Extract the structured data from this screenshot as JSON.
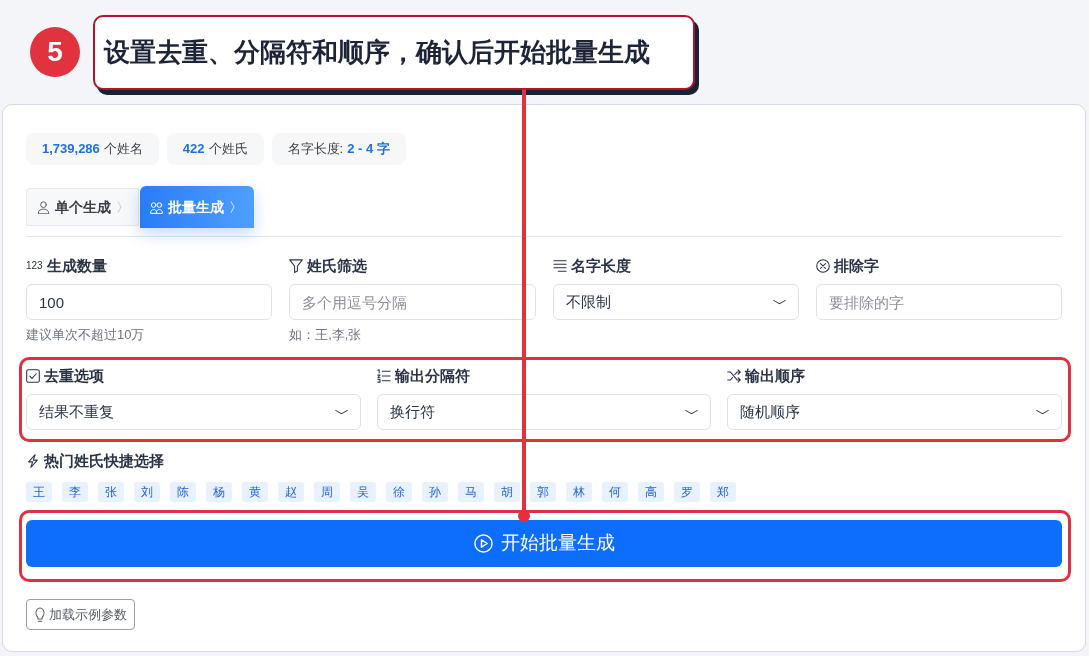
{
  "annotation": {
    "step": "5",
    "text": "设置去重、分隔符和顺序，确认后开始批量生成"
  },
  "stats": [
    {
      "kind": "count",
      "value": "1,739,286",
      "label": "个姓名"
    },
    {
      "kind": "count",
      "value": "422",
      "label": "个姓氏"
    },
    {
      "kind": "range",
      "label": "名字长度:",
      "value": "2 - 4 字"
    }
  ],
  "tabs": [
    {
      "label": "单个生成",
      "selected": false
    },
    {
      "label": "批量生成",
      "selected": true
    }
  ],
  "fields": [
    {
      "kind": "input",
      "glyph": "123",
      "label": "生成数量",
      "value": "100",
      "help": "建议单次不超过10万"
    },
    {
      "kind": "input",
      "label": "姓氏筛选",
      "placeholder": "多个用逗号分隔",
      "help": "如：王,李,张"
    },
    {
      "kind": "select",
      "label": "名字长度",
      "value": "不限制"
    },
    {
      "kind": "input",
      "label": "排除字",
      "placeholder": "要排除的字"
    }
  ],
  "output_options": [
    {
      "label": "去重选项",
      "value": "结果不重复"
    },
    {
      "label": "输出分隔符",
      "value": "换行符"
    },
    {
      "label": "输出顺序",
      "value": "随机顺序"
    }
  ],
  "surname_shortcuts": {
    "label": "热门姓氏快捷选择",
    "items": [
      "王",
      "李",
      "张",
      "刘",
      "陈",
      "杨",
      "黄",
      "赵",
      "周",
      "吴",
      "徐",
      "孙",
      "马",
      "胡",
      "郭",
      "林",
      "何",
      "高",
      "罗",
      "郑"
    ]
  },
  "generate_button": "开始批量生成",
  "example_button": "加载示例参数"
}
